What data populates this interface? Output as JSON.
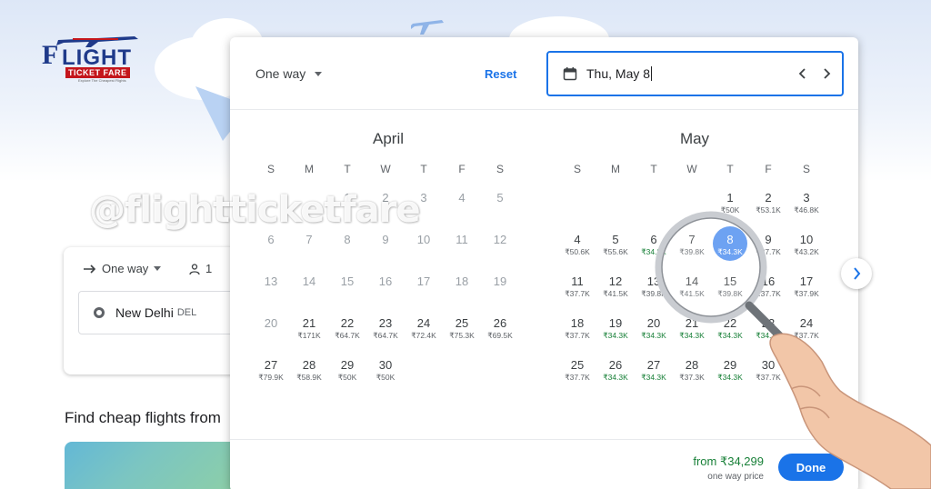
{
  "brand": {
    "logo_letter": "F",
    "logo_word": "LIGHT",
    "logo_band": "TICKET FARE",
    "logo_tagline": "Explore The Cheapest Flights"
  },
  "watermark": "@flightticketfare",
  "search": {
    "trip_type": "One way",
    "passengers": "1",
    "origin_city": "New Delhi",
    "origin_code": "DEL",
    "find_title": "Find cheap flights from"
  },
  "picker": {
    "trip_type": "One way",
    "reset_label": "Reset",
    "date_value": "Thu, May 8",
    "weekdays": [
      "S",
      "M",
      "T",
      "W",
      "T",
      "F",
      "S"
    ],
    "months": [
      {
        "name": "April",
        "days": [
          {
            "d": "",
            "p": ""
          },
          {
            "d": "",
            "p": ""
          },
          {
            "d": "1",
            "p": "",
            "past": true
          },
          {
            "d": "2",
            "p": "",
            "past": true
          },
          {
            "d": "3",
            "p": "",
            "past": true
          },
          {
            "d": "4",
            "p": "",
            "past": true
          },
          {
            "d": "5",
            "p": "",
            "past": true
          },
          {
            "d": "6",
            "p": "",
            "past": true
          },
          {
            "d": "7",
            "p": "",
            "past": true
          },
          {
            "d": "8",
            "p": "",
            "past": true
          },
          {
            "d": "9",
            "p": "",
            "past": true
          },
          {
            "d": "10",
            "p": "",
            "past": true
          },
          {
            "d": "11",
            "p": "",
            "past": true
          },
          {
            "d": "12",
            "p": "",
            "past": true
          },
          {
            "d": "13",
            "p": "",
            "past": true
          },
          {
            "d": "14",
            "p": "",
            "past": true
          },
          {
            "d": "15",
            "p": "",
            "past": true
          },
          {
            "d": "16",
            "p": "",
            "past": true
          },
          {
            "d": "17",
            "p": "",
            "past": true
          },
          {
            "d": "18",
            "p": "",
            "past": true
          },
          {
            "d": "19",
            "p": "",
            "past": true
          },
          {
            "d": "20",
            "p": "",
            "past": true
          },
          {
            "d": "21",
            "p": "₹171K"
          },
          {
            "d": "22",
            "p": "₹64.7K"
          },
          {
            "d": "23",
            "p": "₹64.7K"
          },
          {
            "d": "24",
            "p": "₹72.4K"
          },
          {
            "d": "25",
            "p": "₹75.3K"
          },
          {
            "d": "26",
            "p": "₹69.5K"
          },
          {
            "d": "27",
            "p": "₹79.9K"
          },
          {
            "d": "28",
            "p": "₹58.9K"
          },
          {
            "d": "29",
            "p": "₹50K"
          },
          {
            "d": "30",
            "p": "₹50K"
          }
        ]
      },
      {
        "name": "May",
        "days": [
          {
            "d": "",
            "p": ""
          },
          {
            "d": "",
            "p": ""
          },
          {
            "d": "",
            "p": ""
          },
          {
            "d": "",
            "p": ""
          },
          {
            "d": "1",
            "p": "₹50K"
          },
          {
            "d": "2",
            "p": "₹53.1K"
          },
          {
            "d": "3",
            "p": "₹46.8K"
          },
          {
            "d": "4",
            "p": "₹50.6K"
          },
          {
            "d": "5",
            "p": "₹55.6K"
          },
          {
            "d": "6",
            "p": "₹34.3K",
            "low": true
          },
          {
            "d": "7",
            "p": "₹39.8K"
          },
          {
            "d": "8",
            "p": "₹34.3K",
            "low": true,
            "selected": true
          },
          {
            "d": "9",
            "p": "₹37.7K"
          },
          {
            "d": "10",
            "p": "₹43.2K"
          },
          {
            "d": "11",
            "p": "₹37.7K"
          },
          {
            "d": "12",
            "p": "₹41.5K"
          },
          {
            "d": "13",
            "p": "₹39.8K"
          },
          {
            "d": "14",
            "p": "₹41.5K"
          },
          {
            "d": "15",
            "p": "₹39.8K"
          },
          {
            "d": "16",
            "p": "₹37.7K"
          },
          {
            "d": "17",
            "p": "₹37.9K"
          },
          {
            "d": "18",
            "p": "₹37.7K"
          },
          {
            "d": "19",
            "p": "₹34.3K",
            "low": true
          },
          {
            "d": "20",
            "p": "₹34.3K",
            "low": true
          },
          {
            "d": "21",
            "p": "₹34.3K",
            "low": true
          },
          {
            "d": "22",
            "p": "₹34.3K",
            "low": true
          },
          {
            "d": "23",
            "p": "₹34.3K",
            "low": true
          },
          {
            "d": "24",
            "p": "₹37.7K"
          },
          {
            "d": "25",
            "p": "₹37.7K"
          },
          {
            "d": "26",
            "p": "₹34.3K",
            "low": true
          },
          {
            "d": "27",
            "p": "₹34.3K",
            "low": true
          },
          {
            "d": "28",
            "p": "₹37.3K"
          },
          {
            "d": "29",
            "p": "₹34.3K",
            "low": true
          },
          {
            "d": "30",
            "p": "₹37.7K"
          }
        ]
      }
    ],
    "from_price": "from ₹34,299",
    "from_label": "one way price",
    "done_label": "Done"
  },
  "colors": {
    "accent": "#1a73e8",
    "selected": "#4d8ef0",
    "low_price": "#188038"
  },
  "icons": [
    "arrow-right-icon",
    "person-icon",
    "calendar-icon",
    "chevron-left-icon",
    "chevron-right-icon",
    "origin-ring-icon",
    "magnifier-icon"
  ]
}
